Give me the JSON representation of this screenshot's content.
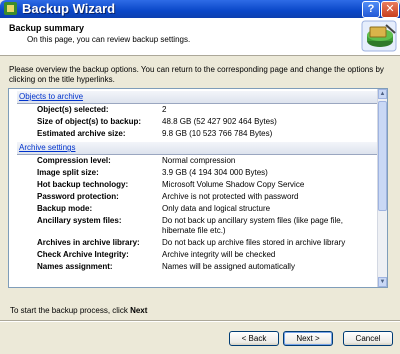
{
  "window": {
    "title": "Backup Wizard",
    "help_label": "?",
    "close_label": "✕"
  },
  "header": {
    "title": "Backup summary",
    "subtitle": "On this page, you can review backup settings."
  },
  "intro": "Please overview the backup options. You can return to the corresponding page and change the options by clicking on the title hyperlinks.",
  "sections": [
    {
      "title": "Objects to archive",
      "rows": [
        {
          "label": "Object(s) selected:",
          "value": "2"
        },
        {
          "label": "Size of object(s) to backup:",
          "value": "48.8 GB (52 427 902 464 Bytes)"
        },
        {
          "label": "Estimated archive size:",
          "value": "9.8 GB (10 523 766 784 Bytes)"
        }
      ]
    },
    {
      "title": "Archive settings",
      "rows": [
        {
          "label": "Compression level:",
          "value": "Normal compression"
        },
        {
          "label": "Image split size:",
          "value": "3.9 GB (4 194 304 000 Bytes)"
        },
        {
          "label": "Hot backup technology:",
          "value": "Microsoft Volume Shadow Copy Service"
        },
        {
          "label": "Password protection:",
          "value": "Archive is not protected with password"
        },
        {
          "label": "Backup mode:",
          "value": "Only data and logical structure"
        },
        {
          "label": "Ancillary system files:",
          "value": "Do not back up ancillary system files (like page file, hibernate file etc.)"
        },
        {
          "label": "Archives in archive library:",
          "value": "Do not back up archive files stored in archive library"
        },
        {
          "label": "Check Archive Integrity:",
          "value": "Archive integrity will be checked"
        },
        {
          "label": "Names assignment:",
          "value": "Names will be assigned automatically"
        }
      ]
    }
  ],
  "footer": {
    "prefix": "To start the backup process, click ",
    "bold": "Next"
  },
  "buttons": {
    "back": "< Back",
    "next": "Next >",
    "cancel": "Cancel"
  },
  "colors": {
    "titlebar": "#0a47c8",
    "link": "#0033cc",
    "dialog_bg": "#ece9d8"
  }
}
